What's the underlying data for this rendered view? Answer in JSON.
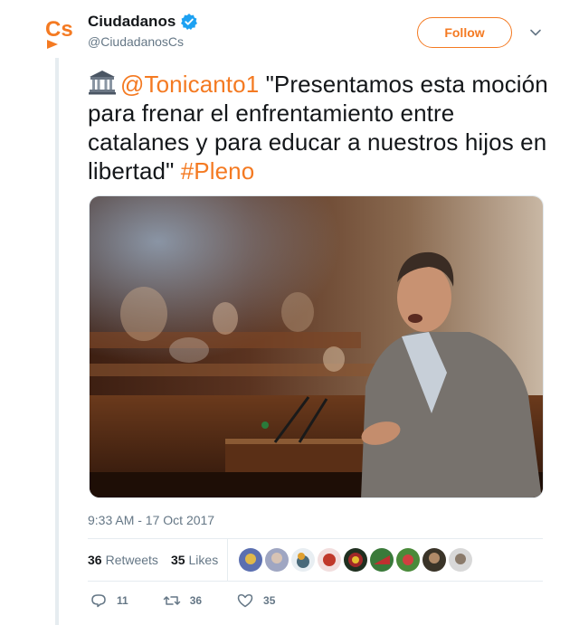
{
  "author": {
    "display_name": "Ciudadanos",
    "handle": "@CiudadanosCs",
    "verified": true,
    "logo_icon": "cs-logo-icon",
    "brand_color": "#f47a22"
  },
  "header": {
    "follow_label": "Follow",
    "menu_icon": "chevron-down-icon"
  },
  "tweet": {
    "emoji_icon": "classical-building-icon",
    "mention": "@Tonicanto1",
    "body": " \"Presentamos esta moción para frenar el enfrentamiento entre catalanes y para educar a nuestros hijos en libertad\" ",
    "hashtag": "#Pleno",
    "photo": "speaker-at-parliament-podium-photo"
  },
  "timestamp": "9:33 AM - 17 Oct 2017",
  "stats": {
    "retweets_count": "36",
    "retweets_label": "Retweets",
    "likes_count": "35",
    "likes_label": "Likes",
    "liker_avatars": [
      "avatar-1",
      "avatar-2",
      "avatar-3",
      "avatar-4",
      "avatar-5",
      "avatar-6",
      "avatar-7",
      "avatar-8",
      "avatar-9"
    ]
  },
  "actions": {
    "reply_count": "11",
    "retweet_count": "36",
    "like_count": "35"
  },
  "colors": {
    "text": "#14171a",
    "secondary": "#657786",
    "link": "#f47a22",
    "border": "#e6ecf0",
    "verified_blue": "#1da1f2"
  }
}
